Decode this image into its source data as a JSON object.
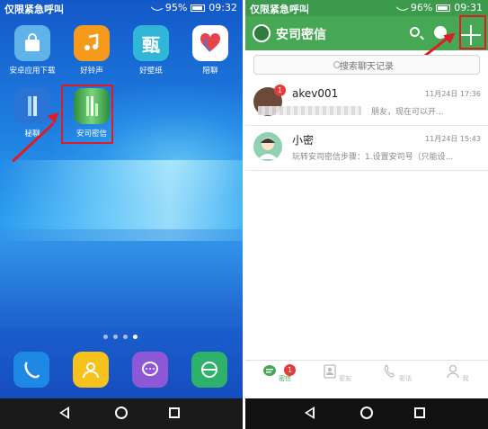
{
  "left_phone": {
    "status": {
      "carrier": "仅限紧急呼叫",
      "battery": "95%",
      "time": "09:32"
    },
    "apps_row1": [
      {
        "label": "安卓应用下载",
        "color": "#5fb3e8",
        "icon": "shopping-bag-icon"
      },
      {
        "label": "好铃声",
        "color": "#f59a1c",
        "icon": "music-note-icon"
      },
      {
        "label": "好壁纸",
        "color": "#2fb6d8",
        "icon": "wallpaper-icon",
        "glyph": "甄"
      },
      {
        "label": "陪聊",
        "color": "#ffffff",
        "icon": "heart-icon"
      }
    ],
    "apps_row2": [
      {
        "label": "秘聊",
        "color": "#2a74d6",
        "icon": "secret-chat-icon"
      },
      {
        "label": "安司密信",
        "color": "#4caf50",
        "icon": "ansi-mixin-icon"
      }
    ],
    "dock": [
      {
        "name": "phone-dock",
        "color": "#1e88e5",
        "icon": "phone-icon"
      },
      {
        "name": "contacts-dock",
        "color": "#f6c21b",
        "icon": "contacts-icon"
      },
      {
        "name": "messages-dock",
        "color": "#8e57d6",
        "icon": "message-icon"
      },
      {
        "name": "browser-dock",
        "color": "#2eb26b",
        "icon": "browser-icon"
      }
    ],
    "page_dots": 4,
    "active_dot": 3
  },
  "right_phone": {
    "status": {
      "carrier": "仅限紧急呼叫",
      "battery": "96%",
      "time": "09:31"
    },
    "app_title": "安司密信",
    "search_placeholder": "搜索聊天记录",
    "chats": [
      {
        "name": "akev001",
        "time": "11月24日 17:36",
        "preview": "朋友，现在可以开...",
        "badge": "1",
        "avatar_color": "#6b4a3a"
      },
      {
        "name": "小密",
        "time": "11月24日 15:43",
        "preview": "玩转安司密信步骤：1.设置安司号（只能设...",
        "badge": "",
        "avatar_color": "#8fd1b0"
      }
    ],
    "tabs": [
      {
        "label": "密信",
        "icon": "chat-bubble-icon",
        "badge": "1",
        "active": true
      },
      {
        "label": "密友",
        "icon": "contact-card-icon",
        "active": false
      },
      {
        "label": "密话",
        "icon": "phone-icon",
        "active": false
      },
      {
        "label": "我",
        "icon": "person-icon",
        "active": false
      }
    ]
  },
  "colors": {
    "highlight_red": "#e01b24",
    "app_green": "#46a855"
  }
}
